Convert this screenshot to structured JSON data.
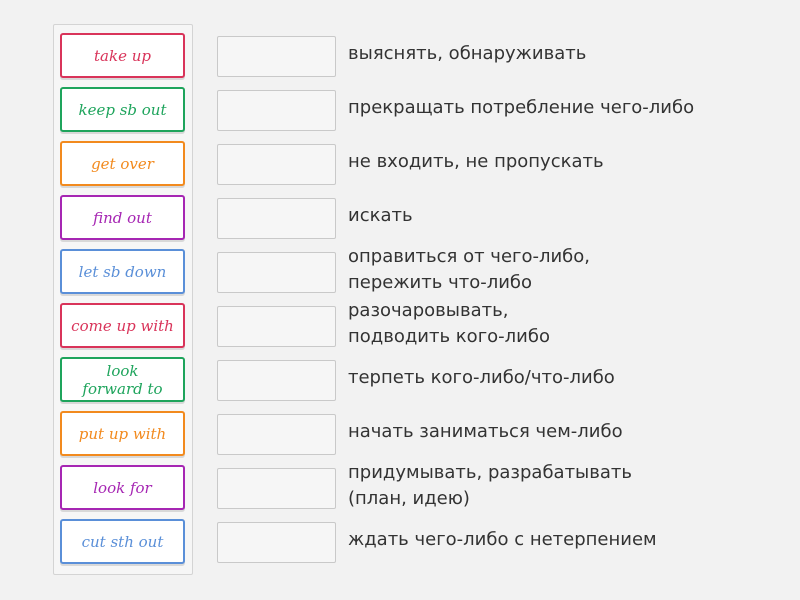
{
  "tiles": [
    {
      "label": "take up",
      "color": "#d9345a"
    },
    {
      "label": "keep sb out",
      "color": "#1ea45c"
    },
    {
      "label": "get over",
      "color": "#f28a1e"
    },
    {
      "label": "find out",
      "color": "#a626b3"
    },
    {
      "label": "let sb down",
      "color": "#5a8fd8"
    },
    {
      "label": "come up with",
      "color": "#d9345a"
    },
    {
      "label": "look forward to",
      "color": "#1ea45c"
    },
    {
      "label": "put up with",
      "color": "#f28a1e"
    },
    {
      "label": "look for",
      "color": "#a626b3"
    },
    {
      "label": "cut sth out",
      "color": "#5a8fd8"
    }
  ],
  "definitions": [
    "выяснять, обнаруживать",
    "прекращать потребление чего-либо",
    "не входить, не пропускать",
    "искать",
    "оправиться от чего-либо, пережить что-либо",
    "разочаровывать, подводить кого-либо",
    "терпеть кого-либо/что-либо",
    "начать заниматься чем-либо",
    "придумывать, разрабатывать (план, идею)",
    "ждать чего-либо с нетерпением"
  ]
}
